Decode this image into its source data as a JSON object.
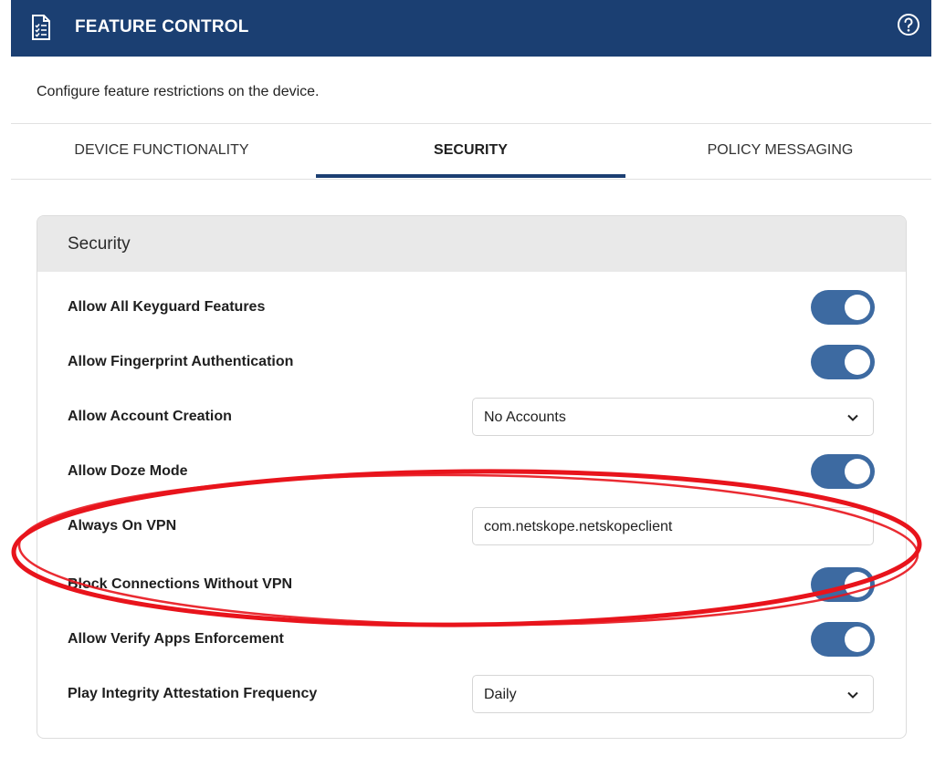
{
  "header": {
    "title": "FEATURE CONTROL",
    "icon": "document-checklist-icon",
    "help_icon": "help-circle-icon",
    "background": "#1b3f72"
  },
  "description": "Configure feature restrictions on the device.",
  "tabs": [
    {
      "label": "DEVICE FUNCTIONALITY",
      "active": false
    },
    {
      "label": "SECURITY",
      "active": true
    },
    {
      "label": "POLICY MESSAGING",
      "active": false
    }
  ],
  "card": {
    "title": "Security",
    "rows": [
      {
        "label": "Allow All Keyguard Features",
        "control": "toggle",
        "on": true
      },
      {
        "label": "Allow Fingerprint Authentication",
        "control": "toggle",
        "on": true
      },
      {
        "label": "Allow Account Creation",
        "control": "select",
        "value": "No Accounts"
      },
      {
        "label": "Allow Doze Mode",
        "control": "toggle",
        "on": true
      },
      {
        "label": "Always On VPN",
        "control": "text",
        "value": "com.netskope.netskopeclient"
      },
      {
        "label": "Block Connections Without VPN",
        "control": "toggle",
        "on": true
      },
      {
        "label": "Allow Verify Apps Enforcement",
        "control": "toggle",
        "on": true
      },
      {
        "label": "Play Integrity Attestation Frequency",
        "control": "select",
        "value": "Daily"
      }
    ]
  },
  "colors": {
    "accent": "#1b3f72",
    "toggle_on": "#3d6aa1",
    "annotation": "#e8141c"
  }
}
